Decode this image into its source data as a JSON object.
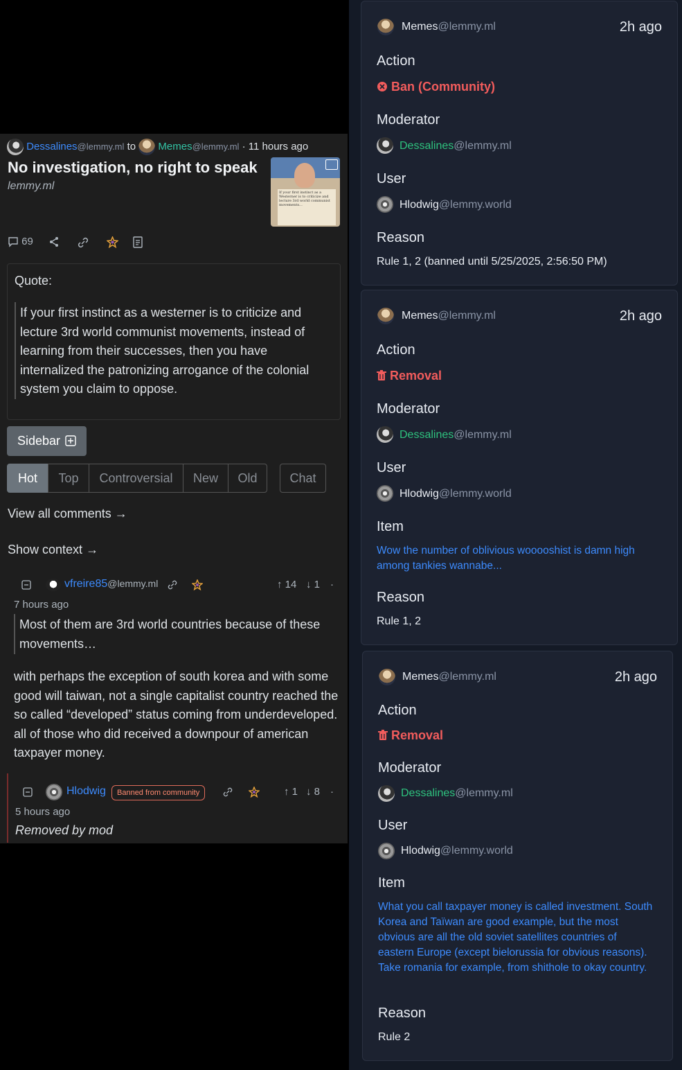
{
  "post": {
    "author": "Dessalines",
    "author_instance": "@lemmy.ml",
    "to_text": "to",
    "community": "Memes",
    "community_instance": "@lemmy.ml",
    "time": "· 11 hours ago",
    "title": "No investigation, no right to speak",
    "domain": "lemmy.ml",
    "comment_count": "69",
    "thumbnail_text": "If your first instinct as a Westerner is to criticize and lecture 3rd world communist movements..."
  },
  "sidebar": {
    "quote_label": "Quote:",
    "quote_text": "If your first instinct as a westerner is to criticize and lecture 3rd world communist movements, instead of learning from their successes, then you have internalized the patronizing arrogance of the colonial system you claim to oppose.",
    "button_label": "Sidebar"
  },
  "sort_tabs": [
    "Hot",
    "Top",
    "Controversial",
    "New",
    "Old"
  ],
  "chat_label": "Chat",
  "view_all_comments": "View all comments →",
  "show_context": "Show context →",
  "comment1": {
    "user": "vfreire85",
    "instance": "@lemmy.ml",
    "upvotes": "↑ 14",
    "downvotes": "↓ 1",
    "dot": "·",
    "time": "7 hours ago",
    "quote": "Most of them are 3rd world countries because of these movements…",
    "body": "with perhaps the exception of south korea and with some good will taiwan, not a single capitalist country reached the so called “developed” status coming from underdeveloped. all of those who did received a downpour of american taxpayer money."
  },
  "comment2": {
    "user": "Hlodwig",
    "badge": "Banned from community",
    "upvotes": "↑ 1",
    "downvotes": "↓ 8",
    "dot": "·",
    "time": "5 hours ago",
    "body": "Removed by mod"
  },
  "modlog": [
    {
      "community": "Memes",
      "community_instance": "@lemmy.ml",
      "time": "2h ago",
      "action_label": "Action",
      "action": "Ban (Community)",
      "moderator_label": "Moderator",
      "moderator": "Dessalines",
      "moderator_instance": "@lemmy.ml",
      "user_label": "User",
      "user": "Hlodwig",
      "user_instance": "@lemmy.world",
      "reason_label": "Reason",
      "reason": "Rule 1, 2 (banned until 5/25/2025, 2:56:50 PM)"
    },
    {
      "community": "Memes",
      "community_instance": "@lemmy.ml",
      "time": "2h ago",
      "action_label": "Action",
      "action": "Removal",
      "moderator_label": "Moderator",
      "moderator": "Dessalines",
      "moderator_instance": "@lemmy.ml",
      "user_label": "User",
      "user": "Hlodwig",
      "user_instance": "@lemmy.world",
      "item_label": "Item",
      "item": "Wow the number of oblivious wooooshist is damn high among tankies wannabe...",
      "reason_label": "Reason",
      "reason": "Rule 1, 2"
    },
    {
      "community": "Memes",
      "community_instance": "@lemmy.ml",
      "time": "2h ago",
      "action_label": "Action",
      "action": "Removal",
      "moderator_label": "Moderator",
      "moderator": "Dessalines",
      "moderator_instance": "@lemmy.ml",
      "user_label": "User",
      "user": "Hlodwig",
      "user_instance": "@lemmy.world",
      "item_label": "Item",
      "item": "What you call taxpayer money is called investment. South Korea and Taïwan are good example, but the most obvious are all the old soviet satellites countries of eastern Europe (except bielorussia for obvious reasons). Take romania for example, from shithole to okay country.",
      "reason_label": "Reason",
      "reason": "Rule 2"
    }
  ],
  "colors": {
    "link_blue": "#3d8bfd",
    "mod_green": "#2ec27e",
    "danger_red": "#f25c5c"
  }
}
